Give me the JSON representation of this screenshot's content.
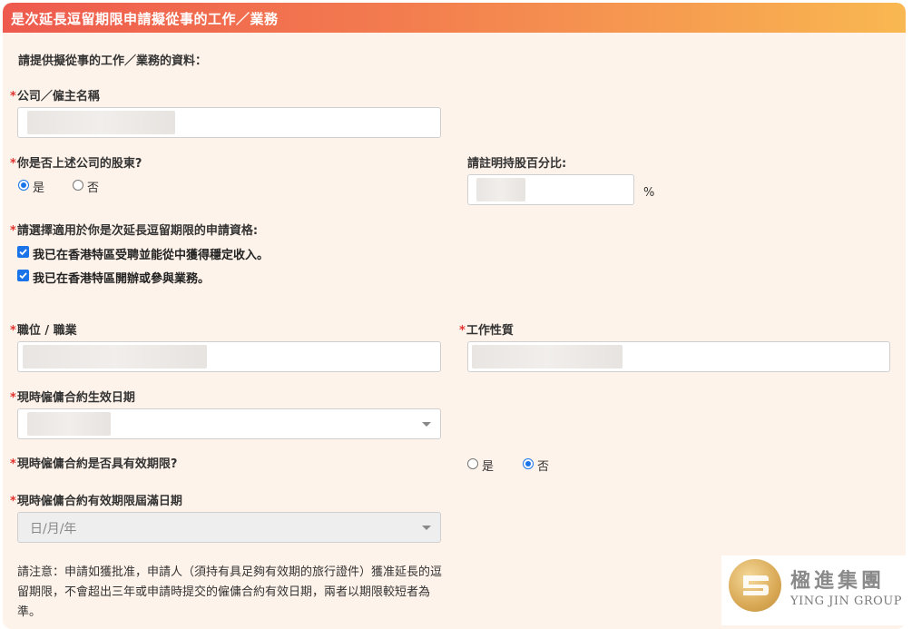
{
  "section": {
    "title": "是次延長逗留期限申請擬從事的工作／業務",
    "intro": "請提供擬從事的工作／業務的資料："
  },
  "required_mark": "*",
  "company": {
    "label": "公司／僱主名稱"
  },
  "shareholder": {
    "label": "你是否上述公司的股東?",
    "options": [
      "是",
      "否"
    ],
    "selected": "是"
  },
  "shareholding": {
    "label": "請註明持股百分比:",
    "unit": "%"
  },
  "eligibility": {
    "label": "請選擇適用於你是次延長逗留期限的申請資格:",
    "options": [
      {
        "label": "我已在香港特區受聘並能從中獲得穩定收入。",
        "checked": true
      },
      {
        "label": "我已在香港特區開辦或參與業務。",
        "checked": true
      }
    ]
  },
  "position": {
    "label": "職位 / 職業"
  },
  "job_nature": {
    "label": "工作性質"
  },
  "effective_date": {
    "label": "現時僱傭合約生效日期"
  },
  "has_validity": {
    "label": "現時僱傭合約是否具有效期限?",
    "options": [
      "是",
      "否"
    ],
    "selected": "否"
  },
  "expiry_date": {
    "label": "現時僱傭合約有效期限屆滿日期",
    "placeholder": "日/月/年"
  },
  "note": "請注意：申請如獲批准，申請人（須持有具足夠有效期的旅行證件）獲准延長的逗留期限，不會超出三年或申請時提交的僱傭合約有效日期，兩者以期限較短者為準。",
  "logo": {
    "cn": "楹進集團",
    "en": "YING JIN GROUP"
  },
  "colors": {
    "accent": "#1a73e8",
    "required": "#e0342f",
    "header_start": "#ee5a4e",
    "header_end": "#f9b851"
  },
  "icons": {
    "checkbox": "check-icon",
    "dropdown": "chevron-down-icon"
  }
}
